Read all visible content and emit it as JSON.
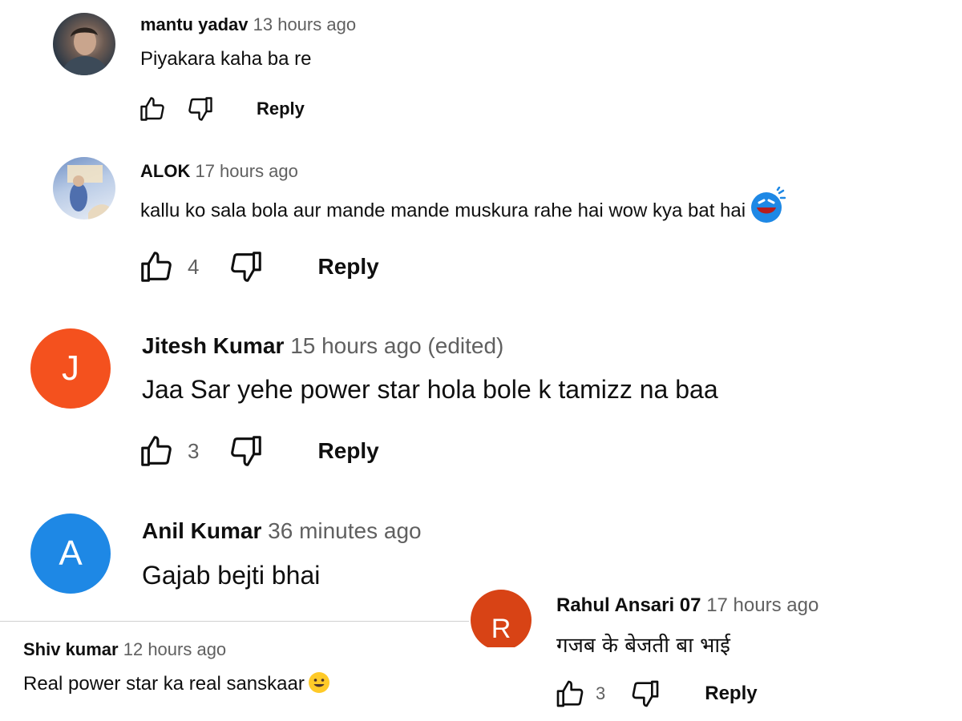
{
  "comments": [
    {
      "author": "mantu yadav",
      "time": "13 hours ago",
      "text": "Piyakara kaha ba re",
      "likes": "",
      "reply": "Reply"
    },
    {
      "author": "ALOK",
      "time": "17 hours ago",
      "text": "kallu ko sala bola aur mande mande muskura rahe hai wow kya bat hai",
      "likes": "4",
      "reply": "Reply"
    },
    {
      "author": "Jitesh Kumar",
      "time": "15 hours ago (edited)",
      "text": "Jaa Sar yehe power star hola bole k tamizz na baa",
      "likes": "3",
      "reply": "Reply",
      "avatar_letter": "J",
      "avatar_color": "#f4511e"
    },
    {
      "author": "Anil Kumar",
      "time": "36 minutes ago",
      "text": "Gajab bejti bhai",
      "avatar_letter": "A",
      "avatar_color": "#1e88e5"
    },
    {
      "author": "Rahul Ansari 07",
      "time": "17 hours ago",
      "text": "गजब के बेजती बा भाई",
      "likes": "3",
      "reply": "Reply",
      "avatar_letter": "R",
      "avatar_color": "#d84315"
    },
    {
      "author": "Shiv kumar",
      "time": "12 hours ago",
      "text": "Real power star ka real sanskaar"
    }
  ],
  "icons": {
    "like": "thumbs-up-icon",
    "dislike": "thumbs-down-icon",
    "laugh_emoji": "laughing-emoji-icon",
    "smile_emoji": "smiling-emoji-icon"
  }
}
